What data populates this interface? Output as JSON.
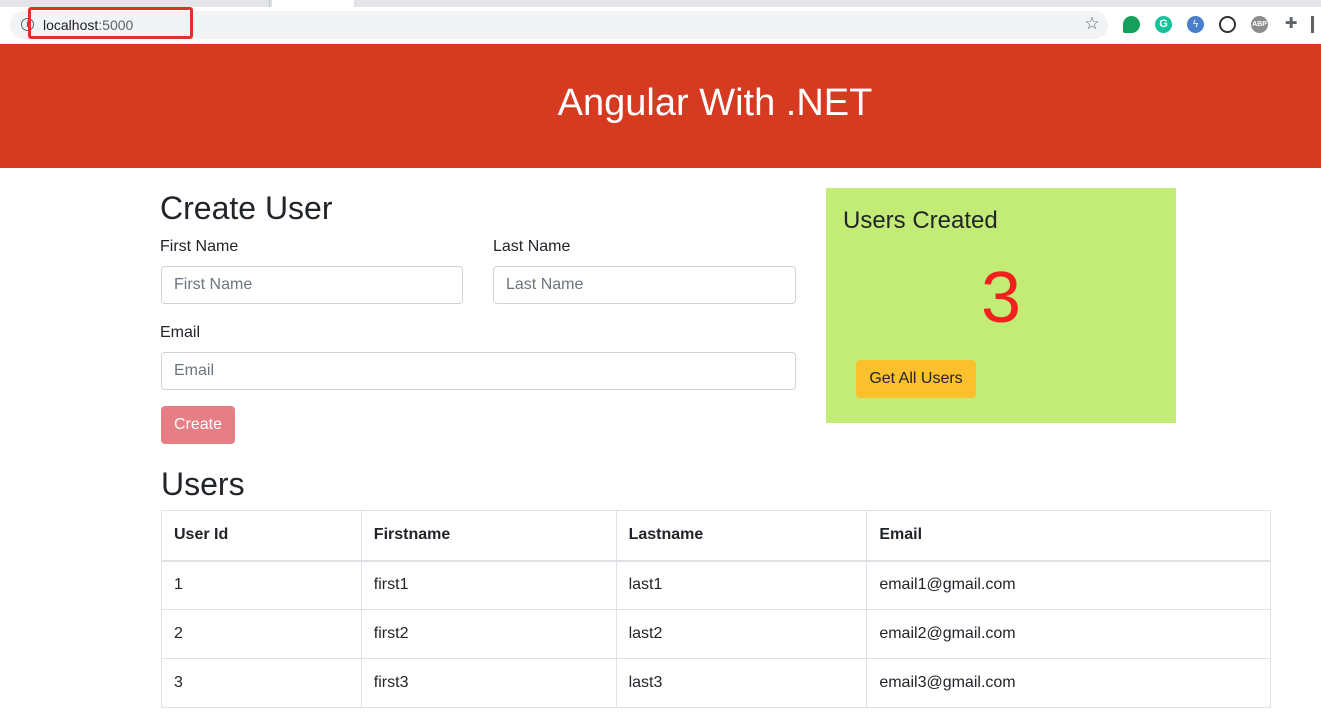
{
  "browser": {
    "url_host": "localhost",
    "url_port": ":5000",
    "icons": [
      "info-icon",
      "star-icon",
      "evernote-icon",
      "grammarly-icon",
      "bolt-icon",
      "sync-icon",
      "adblock-icon",
      "extensions-puzzle-icon",
      "reading-list-icon"
    ]
  },
  "header": {
    "title": "Angular With .NET",
    "background": "#d63a20"
  },
  "create_user": {
    "heading": "Create User",
    "first_name_label": "First Name",
    "first_name_placeholder": "First Name",
    "last_name_label": "Last Name",
    "last_name_placeholder": "Last Name",
    "email_label": "Email",
    "email_placeholder": "Email",
    "create_button": "Create"
  },
  "stats": {
    "title": "Users Created",
    "count": "3",
    "get_all_button": "Get All Users",
    "card_color": "#c2ec76",
    "count_color": "#f32020",
    "button_color": "#fbc02d"
  },
  "users": {
    "heading": "Users",
    "columns": [
      "User Id",
      "Firstname",
      "Lastname",
      "Email"
    ],
    "rows": [
      [
        "1",
        "first1",
        "last1",
        "email1@gmail.com"
      ],
      [
        "2",
        "first2",
        "last2",
        "email2@gmail.com"
      ],
      [
        "3",
        "first3",
        "last3",
        "email3@gmail.com"
      ]
    ]
  }
}
